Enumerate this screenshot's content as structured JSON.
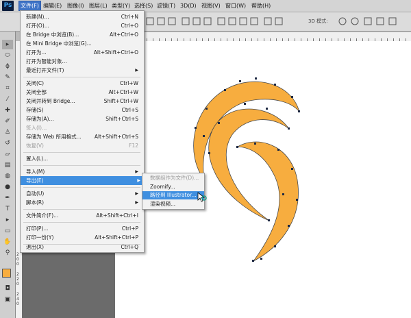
{
  "app": {
    "logo": "Ps",
    "accent": "#3f8fe0",
    "shape_fill": "#f7ad3f"
  },
  "menubar": {
    "items": [
      "文件(F)",
      "编辑(E)",
      "图像(I)",
      "图层(L)",
      "类型(Y)",
      "选择(S)",
      "滤镜(T)",
      "3D(D)",
      "视图(V)",
      "窗口(W)",
      "帮助(H)"
    ]
  },
  "options": {
    "mode_label": "3D 模式:"
  },
  "file_menu": {
    "items": [
      {
        "label": "新建(N)...",
        "shortcut": "Ctrl+N"
      },
      {
        "label": "打开(O)...",
        "shortcut": "Ctrl+O"
      },
      {
        "label": "在 Bridge 中浏览(B)...",
        "shortcut": "Alt+Ctrl+O"
      },
      {
        "label": "在 Mini Bridge 中浏览(G)...",
        "shortcut": ""
      },
      {
        "label": "打开为...",
        "shortcut": "Alt+Shift+Ctrl+O"
      },
      {
        "label": "打开为智能对象...",
        "shortcut": ""
      },
      {
        "label": "最近打开文件(T)",
        "shortcut": ""
      },
      {
        "label": "关闭(C)",
        "shortcut": "Ctrl+W"
      },
      {
        "label": "关闭全部",
        "shortcut": "Alt+Ctrl+W"
      },
      {
        "label": "关闭并转到 Bridge...",
        "shortcut": "Shift+Ctrl+W"
      },
      {
        "label": "存储(S)",
        "shortcut": "Ctrl+S"
      },
      {
        "label": "存储为(A)...",
        "shortcut": "Shift+Ctrl+S"
      },
      {
        "label": "签入(I)...",
        "shortcut": ""
      },
      {
        "label": "存储为 Web 所用格式...",
        "shortcut": "Alt+Shift+Ctrl+S"
      },
      {
        "label": "恢复(V)",
        "shortcut": "F12"
      },
      {
        "label": "置入(L)...",
        "shortcut": ""
      },
      {
        "label": "导入(M)",
        "shortcut": ""
      },
      {
        "label": "导出(E)",
        "shortcut": ""
      },
      {
        "label": "自动(U)",
        "shortcut": ""
      },
      {
        "label": "脚本(R)",
        "shortcut": ""
      },
      {
        "label": "文件简介(F)...",
        "shortcut": "Alt+Shift+Ctrl+I"
      },
      {
        "label": "打印(P)...",
        "shortcut": "Ctrl+P"
      },
      {
        "label": "打印一份(Y)",
        "shortcut": "Alt+Shift+Ctrl+P"
      },
      {
        "label": "退出(X)",
        "shortcut": "Ctrl+Q"
      }
    ]
  },
  "export_submenu": {
    "items": [
      {
        "label": "数据组作为文件(D)..."
      },
      {
        "label": "Zoomify..."
      },
      {
        "label": "路径到 Illustrator..."
      },
      {
        "label": "渲染视频..."
      }
    ]
  },
  "ruler": {
    "left_digits": [
      "2",
      "0",
      "0",
      "2",
      "2",
      "0",
      "2",
      "4",
      "0",
      "2",
      "6",
      "0",
      "2",
      "8",
      "0"
    ]
  }
}
